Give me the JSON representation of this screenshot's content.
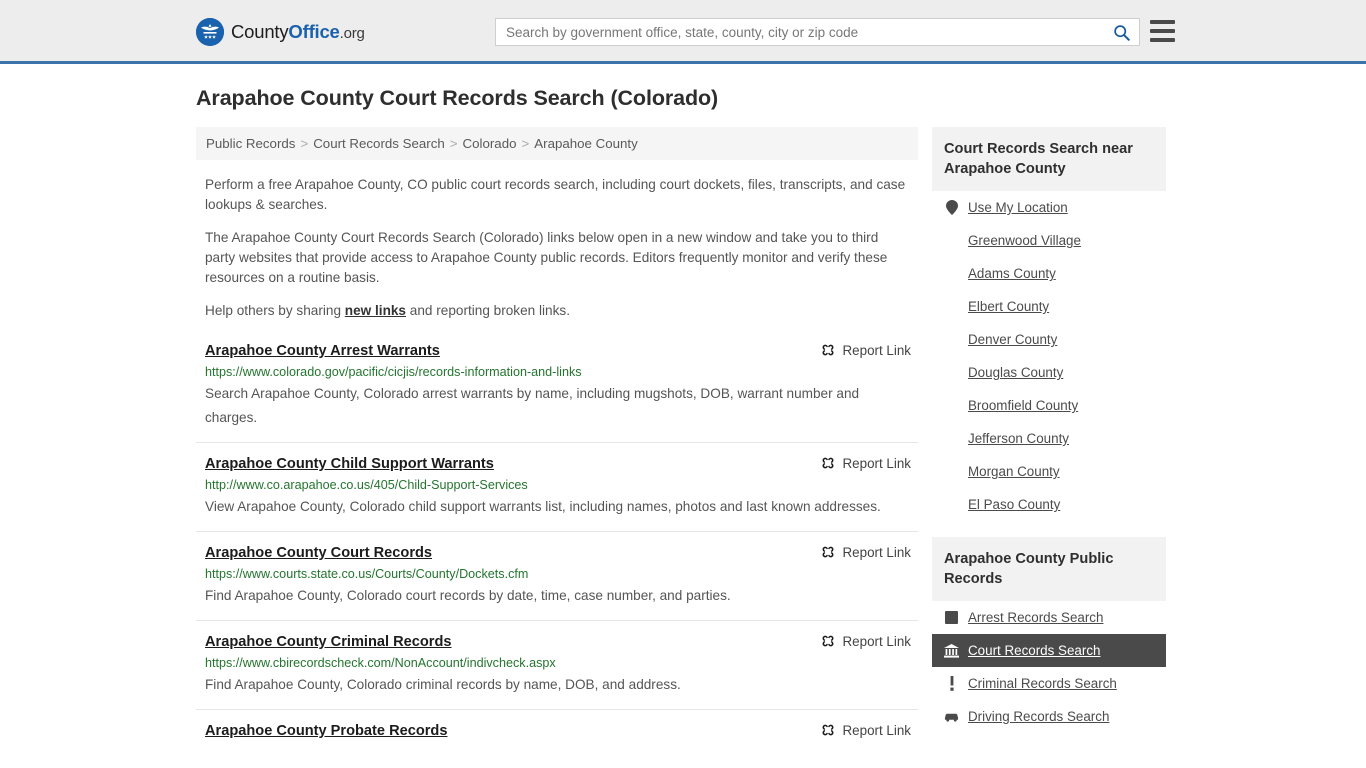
{
  "header": {
    "logo": {
      "part1": "County",
      "part2": "Office",
      "part3": ".org",
      "icon": "eagle-shield-logo-icon"
    },
    "search": {
      "placeholder": "Search by government office, state, county, city or zip code",
      "value": "",
      "button_icon": "search-icon"
    },
    "menu_icon": "hamburger-menu-icon",
    "accent_color": "#3a74ab"
  },
  "page": {
    "title": "Arapahoe County Court Records Search (Colorado)"
  },
  "breadcrumb": {
    "items": [
      {
        "label": "Public Records",
        "current": false
      },
      {
        "label": "Court Records Search",
        "current": false
      },
      {
        "label": "Colorado",
        "current": false
      },
      {
        "label": "Arapahoe County",
        "current": true
      }
    ],
    "separator": ">"
  },
  "intro": {
    "p1": "Perform a free Arapahoe County, CO public court records search, including court dockets, files, transcripts, and case lookups & searches.",
    "p2": "The Arapahoe County Court Records Search (Colorado) links below open in a new window and take you to third party websites that provide access to Arapahoe County public records. Editors frequently monitor and verify these resources on a routine basis.",
    "p3_before": "Help others by sharing ",
    "p3_link": "new links",
    "p3_after": " and reporting broken links."
  },
  "results": {
    "report_label": "Report Link",
    "report_icon": "broken-link-icon",
    "items": [
      {
        "title": "Arapahoe County Arrest Warrants",
        "url": "https://www.colorado.gov/pacific/cicjis/records-information-and-links",
        "description": "Search Arapahoe County, Colorado arrest warrants by name, including mugshots, DOB, warrant number and charges."
      },
      {
        "title": "Arapahoe County Child Support Warrants",
        "url": "http://www.co.arapahoe.co.us/405/Child-Support-Services",
        "description": "View Arapahoe County, Colorado child support warrants list, including names, photos and last known addresses."
      },
      {
        "title": "Arapahoe County Court Records",
        "url": "https://www.courts.state.co.us/Courts/County/Dockets.cfm",
        "description": "Find Arapahoe County, Colorado court records by date, time, case number, and parties."
      },
      {
        "title": "Arapahoe County Criminal Records",
        "url": "https://www.cbirecordscheck.com/NonAccount/indivcheck.aspx",
        "description": "Find Arapahoe County, Colorado criminal records by name, DOB, and address."
      },
      {
        "title": "Arapahoe County Probate Records",
        "url": "",
        "description": ""
      }
    ]
  },
  "sidebar": {
    "nearby": {
      "heading": "Court Records Search near Arapahoe County",
      "items": [
        {
          "label": "Use My Location",
          "icon": "map-pin-icon",
          "active": false
        },
        {
          "label": "Greenwood Village",
          "icon": "",
          "active": false
        },
        {
          "label": "Adams County",
          "icon": "",
          "active": false
        },
        {
          "label": "Elbert County",
          "icon": "",
          "active": false
        },
        {
          "label": "Denver County",
          "icon": "",
          "active": false
        },
        {
          "label": "Douglas County",
          "icon": "",
          "active": false
        },
        {
          "label": "Broomfield County",
          "icon": "",
          "active": false
        },
        {
          "label": "Jefferson County",
          "icon": "",
          "active": false
        },
        {
          "label": "Morgan County",
          "icon": "",
          "active": false
        },
        {
          "label": "El Paso County",
          "icon": "",
          "active": false
        }
      ]
    },
    "public_records": {
      "heading": "Arapahoe County Public Records",
      "items": [
        {
          "label": "Arrest Records Search",
          "icon": "fingerprint-square-icon",
          "active": false
        },
        {
          "label": "Court Records Search",
          "icon": "courthouse-icon",
          "active": true
        },
        {
          "label": "Criminal Records Search",
          "icon": "exclamation-icon",
          "active": false
        },
        {
          "label": "Driving Records Search",
          "icon": "car-icon",
          "active": false
        }
      ]
    },
    "active_color": "#4a4a4a"
  }
}
